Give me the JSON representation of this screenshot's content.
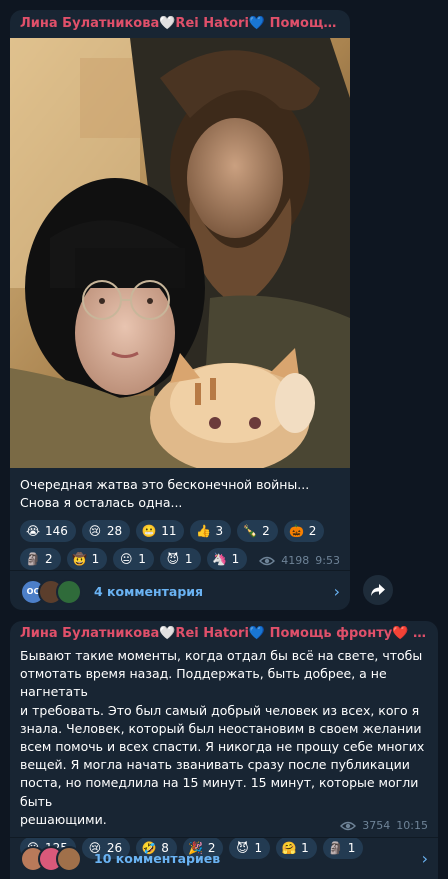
{
  "posts": [
    {
      "author": "Лина Булатникова🤍Rei Hatori💙 Помощь фр...",
      "text_lines": [
        "Очередная жатва это бесконечной войны...",
        "Снова я осталась одна..."
      ],
      "reactions": [
        {
          "icon": "crying-face",
          "emoji": "😭",
          "count": "146"
        },
        {
          "icon": "sad-face",
          "emoji": "😢",
          "count": "28"
        },
        {
          "icon": "grimacing-face",
          "emoji": "😬",
          "count": "11"
        },
        {
          "icon": "thumbs-up",
          "emoji": "👍",
          "count": "3"
        },
        {
          "icon": "champagne",
          "emoji": "🍾",
          "count": "2"
        },
        {
          "icon": "pumpkin",
          "emoji": "🎃",
          "count": "2"
        },
        {
          "icon": "moai",
          "emoji": "🗿",
          "count": "2"
        },
        {
          "icon": "face-with-hat",
          "emoji": "🤠",
          "count": "1"
        },
        {
          "icon": "neutral-face",
          "emoji": "😐",
          "count": "1"
        },
        {
          "icon": "devil-face",
          "emoji": "😈",
          "count": "1"
        },
        {
          "icon": "unicorn",
          "emoji": "🦄",
          "count": "1"
        }
      ],
      "views": "4198",
      "time": "9:53",
      "comments_label": "4 комментария",
      "commenter_avatars": [
        {
          "initials": "ОС",
          "color": "#4c7fc9"
        },
        {
          "initials": "",
          "color": "#5b3e2c"
        },
        {
          "initials": "",
          "color": "#2f6b3a"
        }
      ]
    },
    {
      "author": "Лина Булатникова🤍Rei Hatori💙 Помощь фронту❤️ Стри...",
      "text_lines": [
        "Бывают такие моменты, когда отдал бы всё на свете, чтобы",
        "отмотать время назад. Поддержать, быть добрее, а не нагнетать",
        "и требовать. Это был самый добрый человек из всех, кого я",
        "знала. Человек, который был неостановим в своем желании",
        "всем помочь и всех спасти. Я никогда не прощу себе многих",
        "вещей. Я могла начать званивать сразу после публикации",
        "поста, но помедлила на 15 минут. 15 минут, которые могли быть",
        "решающими."
      ],
      "reactions": [
        {
          "icon": "crying-face",
          "emoji": "😭",
          "count": "125"
        },
        {
          "icon": "sad-face",
          "emoji": "😢",
          "count": "26"
        },
        {
          "icon": "rolling-laughing-face",
          "emoji": "🤣",
          "count": "8"
        },
        {
          "icon": "party-popper",
          "emoji": "🎉",
          "count": "2"
        },
        {
          "icon": "devil-face",
          "emoji": "😈",
          "count": "1"
        },
        {
          "icon": "hugging-face",
          "emoji": "🤗",
          "count": "1"
        },
        {
          "icon": "moai",
          "emoji": "🗿",
          "count": "1"
        }
      ],
      "views": "3754",
      "time": "10:15",
      "comments_label": "10 комментариев",
      "commenter_avatars": [
        {
          "initials": "",
          "color": "#b97a5a"
        },
        {
          "initials": "",
          "color": "#d9597a"
        },
        {
          "initials": "",
          "color": "#a0704a"
        }
      ]
    }
  ],
  "colors": {
    "background": "#0e1621",
    "bubble": "#182533",
    "author": "#e0506a",
    "link": "#6ab3f3",
    "meta": "#6e8397",
    "reaction_bg": "#233b52"
  }
}
